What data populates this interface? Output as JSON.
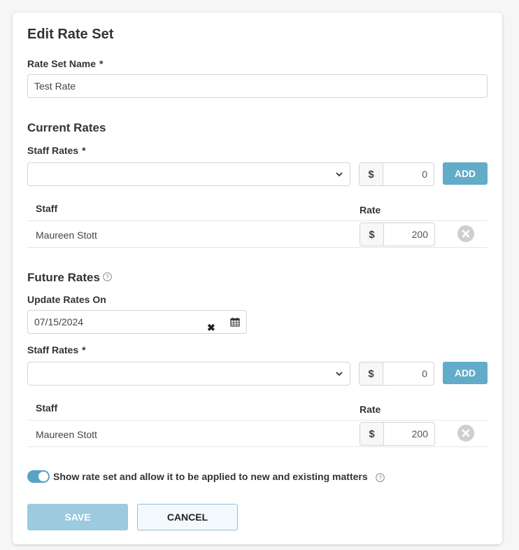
{
  "dialog": {
    "title": "Edit Rate Set",
    "rate_set_name_label": "Rate Set Name",
    "required_marker": "*",
    "rate_set_name_value": "Test Rate"
  },
  "current_rates": {
    "heading": "Current Rates",
    "staff_rates_label": "Staff Rates",
    "staff_select_value": "",
    "currency_symbol": "$",
    "new_rate_value": "0",
    "add_label": "ADD",
    "columns": {
      "staff": "Staff",
      "rate": "Rate"
    },
    "rows": [
      {
        "staff": "Maureen Stott",
        "currency": "$",
        "rate": "200"
      }
    ]
  },
  "future_rates": {
    "heading": "Future Rates",
    "help_icon": "question-circle-icon",
    "update_on_label": "Update Rates On",
    "update_on_value": "07/15/2024",
    "staff_rates_label": "Staff Rates",
    "staff_select_value": "",
    "currency_symbol": "$",
    "new_rate_value": "0",
    "add_label": "ADD",
    "columns": {
      "staff": "Staff",
      "rate": "Rate"
    },
    "rows": [
      {
        "staff": "Maureen Stott",
        "currency": "$",
        "rate": "200"
      }
    ]
  },
  "visibility": {
    "enabled": true,
    "label": "Show rate set and allow it to be applied to new and existing matters"
  },
  "actions": {
    "save_label": "SAVE",
    "cancel_label": "CANCEL"
  },
  "colors": {
    "accent": "#62abc9",
    "save_disabled": "#9ccadf",
    "toggle_on": "#5aa3c4"
  }
}
